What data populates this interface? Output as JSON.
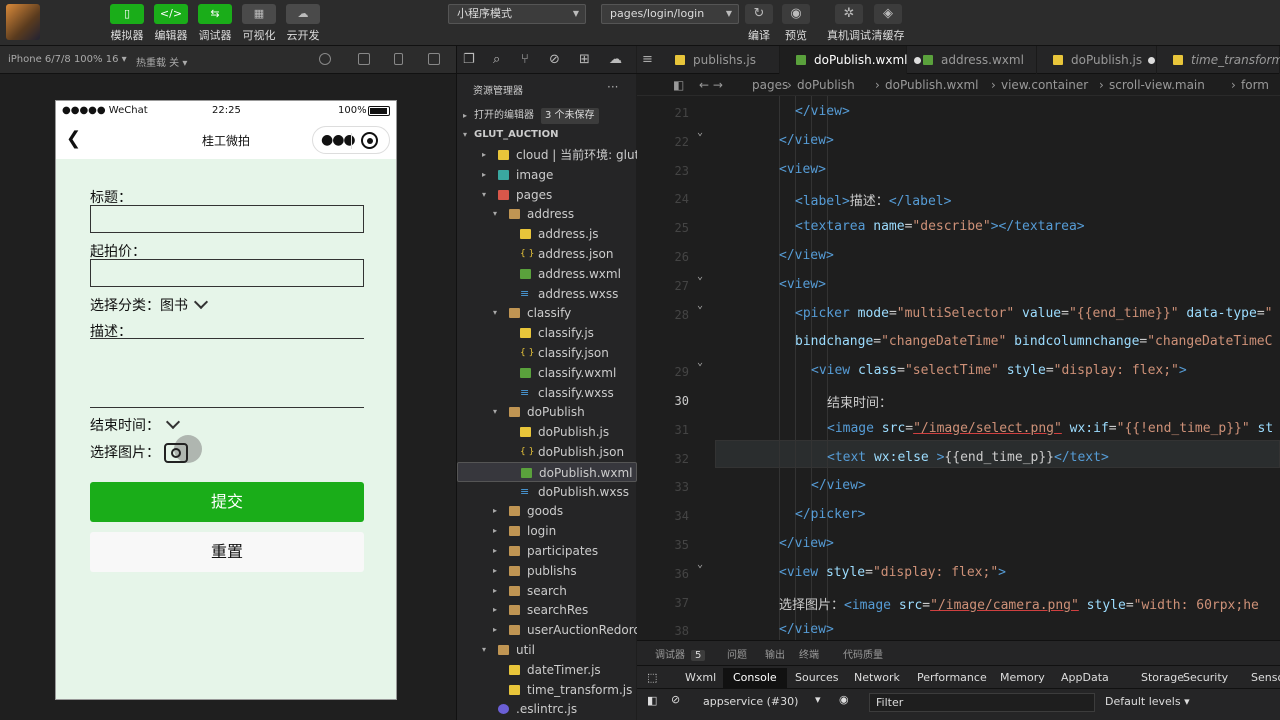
{
  "toolbar": {
    "buttons": [
      {
        "label": "模拟器",
        "icon": "phone-icon",
        "glyph": "▯"
      },
      {
        "label": "编辑器",
        "icon": "code-icon",
        "glyph": "</>"
      },
      {
        "label": "调试器",
        "icon": "debug-icon",
        "glyph": "⇆"
      },
      {
        "label": "可视化",
        "icon": "layout-icon",
        "glyph": "▦"
      },
      {
        "label": "云开发",
        "icon": "cloud-icon",
        "glyph": "☁"
      }
    ],
    "mode_select": "小程序模式",
    "page_select": "pages/login/login",
    "right_buttons": [
      {
        "label": "编译",
        "icon": "refresh-icon",
        "glyph": "↻"
      },
      {
        "label": "预览",
        "icon": "eye-icon",
        "glyph": "◉"
      },
      {
        "label": "真机调试",
        "icon": "bug-icon",
        "glyph": "✲"
      },
      {
        "label": "清缓存",
        "icon": "layers-icon",
        "glyph": "◈"
      }
    ]
  },
  "simulator_bar": {
    "device": "iPhone 6/7/8 100% 16 ▾",
    "hot_reload": "热重载 关 ▾"
  },
  "phone": {
    "status": {
      "carrier": "●●●●● WeChat",
      "time": "22:25",
      "battery": "100%"
    },
    "nav_title": "桂工微拍",
    "form": {
      "title_label": "标题：",
      "price_label": "起拍价：",
      "category_label": "选择分类：",
      "category_value": "图书",
      "describe_label": "描述：",
      "end_time_label": "结束时间：",
      "image_label": "选择图片：",
      "submit_label": "提交",
      "reset_label": "重置"
    }
  },
  "explorer": {
    "title": "资源管理器",
    "open_editors": "打开的编辑器",
    "unsaved_badge": "3 个未保存",
    "project": "GLUT_AUCTION",
    "tree": [
      {
        "label": "cloud | 当前环境: glut-...",
        "type": "cloud",
        "depth": 1,
        "arrow": "▸"
      },
      {
        "label": "image",
        "type": "img",
        "depth": 1,
        "arrow": "▸"
      },
      {
        "label": "pages",
        "type": "pages",
        "depth": 1,
        "arrow": "▾"
      },
      {
        "label": "address",
        "type": "folder",
        "depth": 2,
        "arrow": "▾"
      },
      {
        "label": "address.js",
        "type": "js",
        "depth": 3
      },
      {
        "label": "address.json",
        "type": "json",
        "depth": 3
      },
      {
        "label": "address.wxml",
        "type": "wxml",
        "depth": 3
      },
      {
        "label": "address.wxss",
        "type": "wxss",
        "depth": 3
      },
      {
        "label": "classify",
        "type": "folder",
        "depth": 2,
        "arrow": "▾"
      },
      {
        "label": "classify.js",
        "type": "js",
        "depth": 3
      },
      {
        "label": "classify.json",
        "type": "json",
        "depth": 3
      },
      {
        "label": "classify.wxml",
        "type": "wxml",
        "depth": 3
      },
      {
        "label": "classify.wxss",
        "type": "wxss",
        "depth": 3
      },
      {
        "label": "doPublish",
        "type": "folder",
        "depth": 2,
        "arrow": "▾"
      },
      {
        "label": "doPublish.js",
        "type": "js",
        "depth": 3
      },
      {
        "label": "doPublish.json",
        "type": "json",
        "depth": 3
      },
      {
        "label": "doPublish.wxml",
        "type": "wxml",
        "depth": 3,
        "selected": true
      },
      {
        "label": "doPublish.wxss",
        "type": "wxss",
        "depth": 3
      },
      {
        "label": "goods",
        "type": "folder",
        "depth": 2,
        "arrow": "▸"
      },
      {
        "label": "login",
        "type": "folder",
        "depth": 2,
        "arrow": "▸"
      },
      {
        "label": "participates",
        "type": "folder",
        "depth": 2,
        "arrow": "▸"
      },
      {
        "label": "publishs",
        "type": "folder",
        "depth": 2,
        "arrow": "▸"
      },
      {
        "label": "search",
        "type": "folder",
        "depth": 2,
        "arrow": "▸"
      },
      {
        "label": "searchRes",
        "type": "folder",
        "depth": 2,
        "arrow": "▸"
      },
      {
        "label": "userAuctionRedords",
        "type": "folder",
        "depth": 2,
        "arrow": "▸"
      },
      {
        "label": "util",
        "type": "folder",
        "depth": 1,
        "arrow": "▾"
      },
      {
        "label": "dateTimer.js",
        "type": "js",
        "depth": 2
      },
      {
        "label": "time_transform.js",
        "type": "js",
        "depth": 2
      },
      {
        "label": ".eslintrc.js",
        "type": "eslint",
        "depth": 1
      }
    ]
  },
  "editor": {
    "tabs": [
      {
        "label": "publishs.js",
        "icon": "js",
        "dirty": false
      },
      {
        "label": "doPublish.wxml",
        "icon": "wxml",
        "dirty": true,
        "active": true
      },
      {
        "label": "address.wxml",
        "icon": "wxml",
        "dirty": false
      },
      {
        "label": "doPublish.js",
        "icon": "js",
        "dirty": true
      },
      {
        "label": "time_transform.js",
        "icon": "js",
        "dirty": false
      }
    ],
    "breadcrumb": [
      "pages",
      "doPublish",
      "doPublish.wxml",
      "view.container",
      "scroll-view.main",
      "form"
    ],
    "current_line": "30",
    "lines": [
      {
        "n": "21",
        "indent": 1,
        "html": "<span class=\"t\">&lt;/view&gt;</span>"
      },
      {
        "n": "22",
        "indent": 0,
        "html": "<span class=\"t\">&lt;/view&gt;</span>",
        "fold": true
      },
      {
        "n": "23",
        "indent": 0,
        "html": "<span class=\"t\">&lt;view&gt;</span>"
      },
      {
        "n": "24",
        "indent": 1,
        "html": "<span class=\"t\">&lt;label&gt;</span>描述：<span class=\"t\">&lt;/label&gt;</span>"
      },
      {
        "n": "25",
        "indent": 1,
        "html": "<span class=\"t\">&lt;textarea</span> <span class=\"a\">name</span>=<span class=\"s\">\"describe\"</span><span class=\"t\">&gt;&lt;/textarea&gt;</span>"
      },
      {
        "n": "26",
        "indent": 0,
        "html": "<span class=\"t\">&lt;/view&gt;</span>"
      },
      {
        "n": "27",
        "indent": 0,
        "html": "<span class=\"t\">&lt;view&gt;</span>",
        "fold": true
      },
      {
        "n": "28",
        "indent": 1,
        "html": "<span class=\"t\">&lt;picker</span> <span class=\"a\">mode</span>=<span class=\"s\">\"multiSelector\"</span> <span class=\"a\">value</span>=<span class=\"s\">\"{{end_time}}\"</span> <span class=\"a\">data-type</span>=<span class=\"s\">\"</span>",
        "fold": true
      },
      {
        "n": "",
        "indent": 1,
        "html": "<span class=\"a\">bindchange</span>=<span class=\"s\">\"changeDateTime\"</span> <span class=\"a\">bindcolumnchange</span>=<span class=\"s\">\"changeDateTimeC</span>"
      },
      {
        "n": "29",
        "indent": 2,
        "html": "<span class=\"t\">&lt;view</span> <span class=\"a\">class</span>=<span class=\"s\">\"selectTime\"</span> <span class=\"a\">style</span>=<span class=\"s\">\"display: flex;\"</span><span class=\"t\">&gt;</span>",
        "fold": true
      },
      {
        "n": "30",
        "indent": 3,
        "html": "结束时间：",
        "current": true
      },
      {
        "n": "31",
        "indent": 3,
        "html": "<span class=\"t\">&lt;image</span> <span class=\"a\">src</span>=<span class=\"s\" style=\"text-decoration:underline;text-decoration-color:#d04040\">\"/image/select.png\"</span> <span class=\"a\">wx:if</span>=<span class=\"s\">\"{{!end_time_p}}\"</span> <span class=\"a\">st</span>"
      },
      {
        "n": "32",
        "indent": 3,
        "html": "<span class=\"t\">&lt;text</span> <span class=\"a\">wx:else</span> <span class=\"t\">&gt;</span>{{end_time_p}}<span class=\"t\">&lt;/text&gt;</span>"
      },
      {
        "n": "33",
        "indent": 2,
        "html": "<span class=\"t\">&lt;/view&gt;</span>"
      },
      {
        "n": "34",
        "indent": 1,
        "html": "<span class=\"t\">&lt;/picker&gt;</span>"
      },
      {
        "n": "35",
        "indent": 0,
        "html": "<span class=\"t\">&lt;/view&gt;</span>"
      },
      {
        "n": "36",
        "indent": 0,
        "html": "<span class=\"t\">&lt;view</span> <span class=\"a\">style</span>=<span class=\"s\">\"display: flex;\"</span><span class=\"t\">&gt;</span>",
        "fold": true
      },
      {
        "n": "37",
        "indent": 0,
        "html": "选择图片：<span class=\"t\">&lt;image</span> <span class=\"a\">src</span>=<span class=\"s\" style=\"text-decoration:underline;text-decoration-color:#d04040\">\"/image/camera.png\"</span> <span class=\"a\">style</span>=<span class=\"s\">\"width: 60rpx;he</span>"
      },
      {
        "n": "38",
        "indent": 0,
        "html": "<span class=\"t\">&lt;/view&gt;</span>"
      }
    ]
  },
  "panel": {
    "tabs": [
      {
        "label": "调试器",
        "count": "5"
      },
      {
        "label": "问题"
      },
      {
        "label": "输出"
      },
      {
        "label": "终端"
      },
      {
        "label": "代码质量"
      }
    ],
    "devtools_tabs": [
      "Wxml",
      "Console",
      "Sources",
      "Network",
      "Performance",
      "Memory",
      "AppData",
      "Storage",
      "Security",
      "Sensor"
    ],
    "active_devtool": "Console",
    "context": "appservice (#30)",
    "filter_placeholder": "Filter",
    "levels": "Default levels ▾"
  },
  "colors": {
    "accent": "#1aad19",
    "phone_bg": "#e6f5e9",
    "editor_bg": "#1e1e1e"
  }
}
